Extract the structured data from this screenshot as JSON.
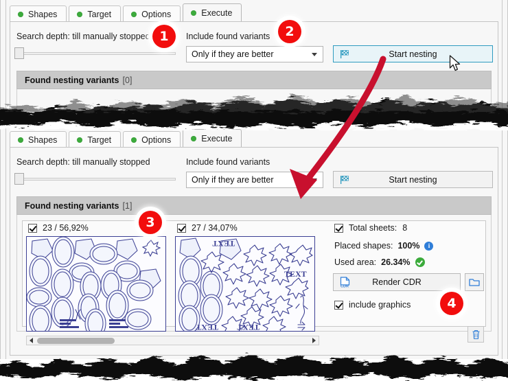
{
  "tabs": [
    {
      "label": "Shapes",
      "active": false
    },
    {
      "label": "Target",
      "active": false
    },
    {
      "label": "Options",
      "active": false
    },
    {
      "label": "Execute",
      "active": true
    }
  ],
  "panel_top": {
    "search_depth_label": "Search depth: till manually stopped",
    "include_label": "Include found variants",
    "include_value": "Only if they are better",
    "start_button": "Start nesting",
    "group_title": "Found nesting variants",
    "group_count": "[0]"
  },
  "panel_bottom": {
    "search_depth_label": "Search depth: till manually stopped",
    "include_label": "Include found variants",
    "include_value": "Only if they are better",
    "start_button": "Start nesting",
    "group_title": "Found nesting variants",
    "group_count": "[1]",
    "variants": [
      {
        "label": "23 / 56,92%",
        "checked": true
      },
      {
        "label": "27 / 34,07%",
        "checked": true
      }
    ],
    "stats": {
      "total_sheets_label": "Total sheets:",
      "total_sheets_value": "8",
      "placed_shapes_label": "Placed shapes:",
      "placed_shapes_value": "100%",
      "used_area_label": "Used area:",
      "used_area_value": "26.34%"
    },
    "render_button": "Render CDR",
    "render_icon_label": "CDR",
    "include_graphics": "include graphics",
    "preview_text_label": "TEXT"
  },
  "annotations": {
    "badges": [
      "1",
      "2",
      "3",
      "4"
    ],
    "arrow_color": "#C8102E",
    "badge_color": "#F20D0D"
  },
  "colors": {
    "tab_dot": "#3CAB3C",
    "accent_blue": "#2E9BC0",
    "info_blue": "#2F7ED8",
    "ok_green": "#3CAB3C",
    "preview_stroke": "#3B3F93"
  }
}
